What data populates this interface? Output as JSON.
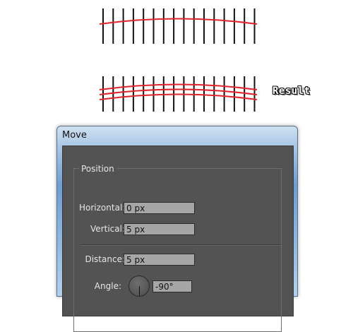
{
  "illustration": {
    "result_label": "Result"
  },
  "dialog": {
    "title": "Move",
    "position_group": "Position",
    "horizontal_label": "Horizontal:",
    "horizontal_value": "0 px",
    "vertical_label": "Vertical:",
    "vertical_value": "5 px",
    "distance_label": "Distance:",
    "distance_value": "5 px",
    "angle_label": "Angle:",
    "angle_value": "-90°"
  },
  "colors": {
    "curve": "#e0242b",
    "tick": "#111111",
    "dialog_bg": "#535353",
    "field_bg": "#a6a6a6"
  }
}
